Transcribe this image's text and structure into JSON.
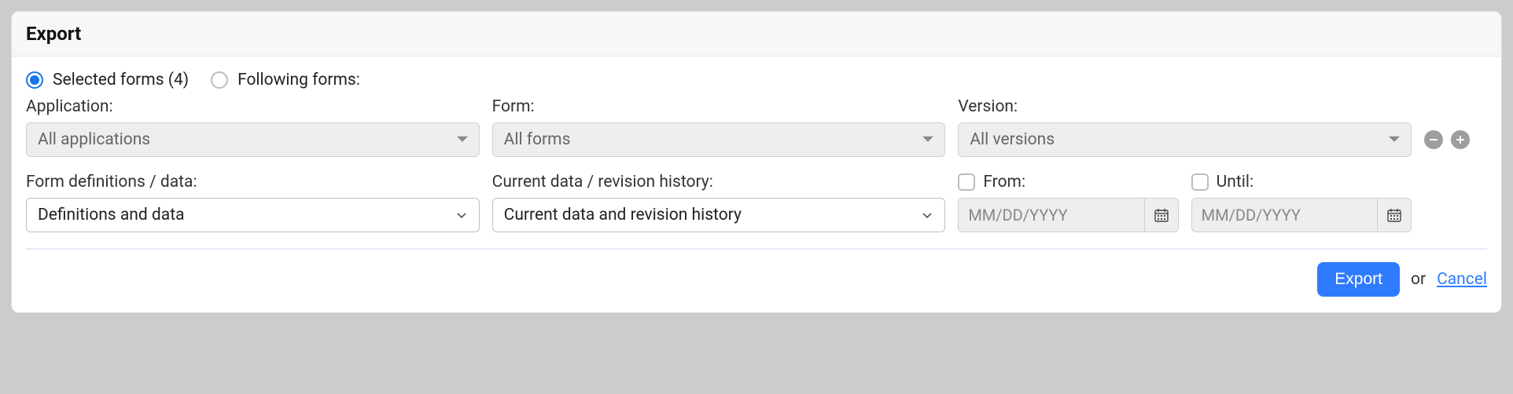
{
  "header": {
    "title": "Export"
  },
  "modeRadios": {
    "selected": {
      "label": "Selected forms (4)",
      "checked": true
    },
    "following": {
      "label": "Following forms:",
      "checked": false
    }
  },
  "filters": {
    "application": {
      "label": "Application:",
      "value": "All applications"
    },
    "form": {
      "label": "Form:",
      "value": "All forms"
    },
    "version": {
      "label": "Version:",
      "value": "All versions"
    }
  },
  "row2": {
    "defs": {
      "label": "Form definitions / data:",
      "value": "Definitions and data"
    },
    "revision": {
      "label": "Current data / revision history:",
      "value": "Current data and revision history"
    },
    "from": {
      "label": "From:",
      "placeholder": "MM/DD/YYYY",
      "checked": false
    },
    "until": {
      "label": "Until:",
      "placeholder": "MM/DD/YYYY",
      "checked": false
    }
  },
  "footer": {
    "export": "Export",
    "or": "or",
    "cancel": "Cancel"
  }
}
